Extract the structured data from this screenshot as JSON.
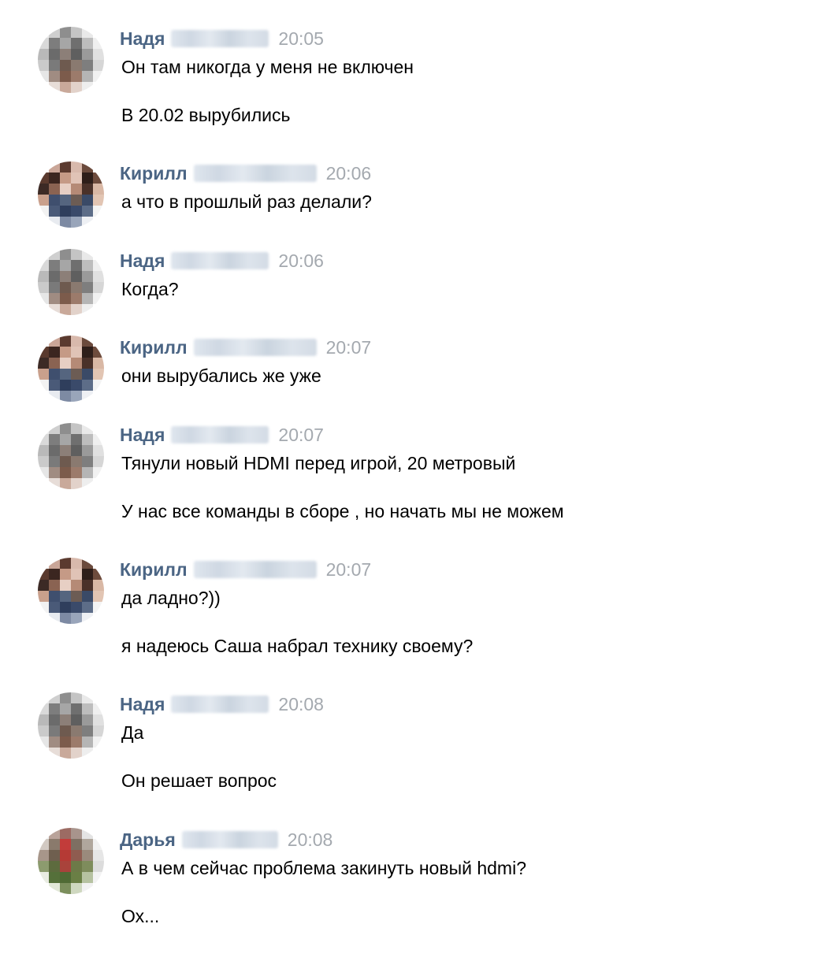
{
  "messages": [
    {
      "author": "Надя",
      "time": "20:05",
      "lines": [
        "Он там никогда у меня не включен",
        "В 20.02 вырубились"
      ]
    },
    {
      "author": "Кирилл",
      "time": "20:06",
      "lines": [
        "а что в прошлый раз делали?"
      ]
    },
    {
      "author": "Надя",
      "time": "20:06",
      "lines": [
        "Когда?"
      ]
    },
    {
      "author": "Кирилл",
      "time": "20:07",
      "lines": [
        "они вырубались же уже"
      ]
    },
    {
      "author": "Надя",
      "time": "20:07",
      "lines": [
        "Тянули новый HDMI перед игрой, 20 метровый",
        "У нас все команды в сборе , но начать мы не можем"
      ]
    },
    {
      "author": "Кирилл",
      "time": "20:07",
      "lines": [
        "да ладно?))",
        "я надеюсь Саша набрал технику своему?"
      ]
    },
    {
      "author": "Надя",
      "time": "20:08",
      "lines": [
        "Да",
        "Он решает вопрос"
      ]
    },
    {
      "author": "Дарья",
      "time": "20:08",
      "lines": [
        "А в чем сейчас проблема закинуть новый hdmi?",
        "Ох..."
      ]
    }
  ],
  "colors": {
    "author_name": "#4b6584",
    "timestamp": "#a4a9af",
    "message_text": "#000000",
    "background": "#ffffff"
  }
}
